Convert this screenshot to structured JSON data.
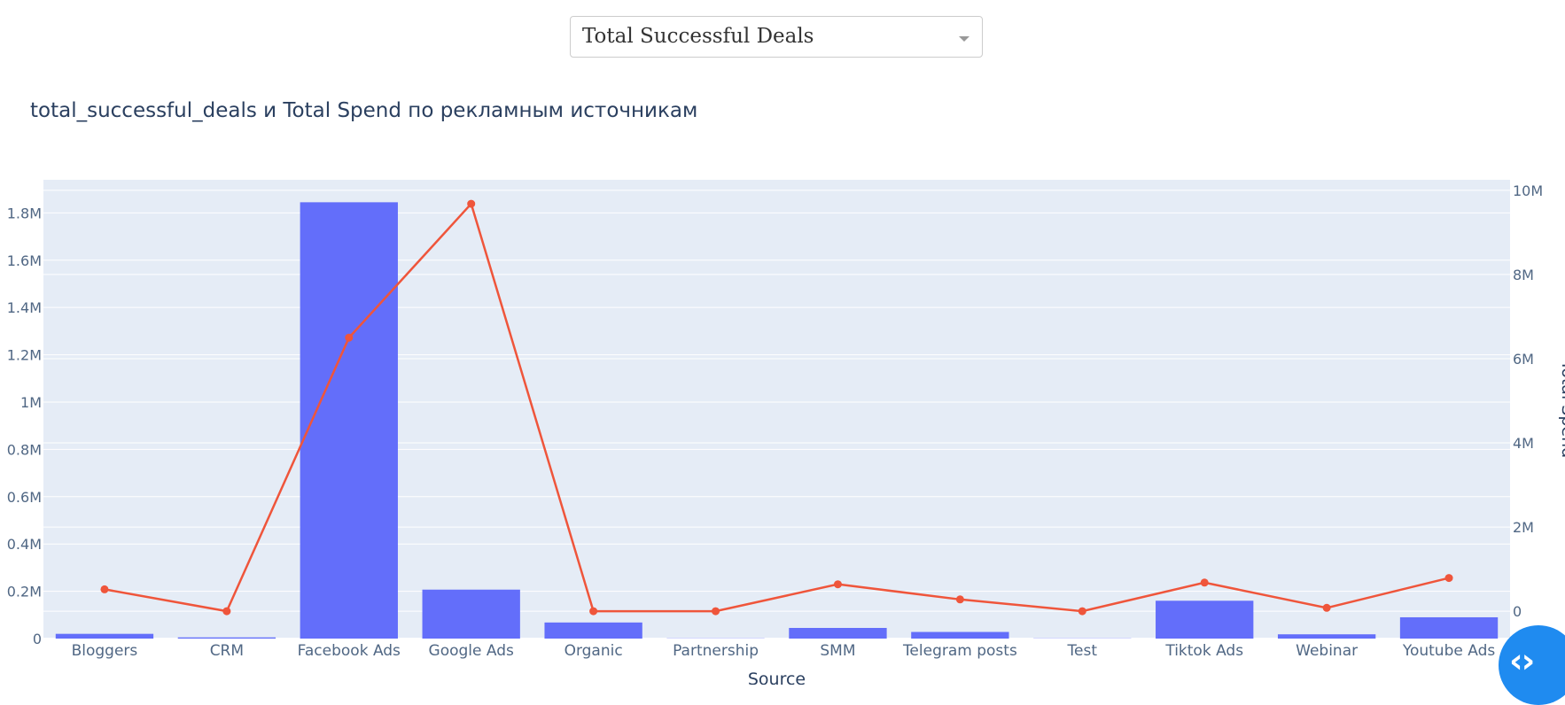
{
  "dropdown": {
    "selected": "Total Successful Deals"
  },
  "nav": {
    "icon": "code-arrows-icon",
    "glyph": "‹›"
  },
  "chart_data": {
    "type": "bar",
    "title": "total_successful_deals и Total Spend по рекламным источникам",
    "xlabel": "Source",
    "ylabel_left": "",
    "ylabel_right": "Total Spend",
    "categories": [
      "Bloggers",
      "CRM",
      "Facebook Ads",
      "Google Ads",
      "Organic",
      "Partnership",
      "SMM",
      "Telegram posts",
      "Test",
      "Tiktok Ads",
      "Webinar",
      "Youtube Ads"
    ],
    "y_left": {
      "range": [
        0,
        1940000
      ],
      "ticks": [
        0,
        200000,
        400000,
        600000,
        800000,
        1000000,
        1200000,
        1400000,
        1600000,
        1800000
      ],
      "tick_labels": [
        "0",
        "0.2M",
        "0.4M",
        "0.6M",
        "0.8M",
        "1M",
        "1.2M",
        "1.4M",
        "1.6M",
        "1.8M"
      ]
    },
    "y_right": {
      "range": [
        -650000,
        10250000
      ],
      "ticks": [
        0,
        2000000,
        4000000,
        6000000,
        8000000,
        10000000
      ],
      "tick_labels": [
        "0",
        "2M",
        "4M",
        "6M",
        "8M",
        "10M"
      ]
    },
    "grid": true,
    "series": [
      {
        "name": "total_successful_deals",
        "type": "bar",
        "axis": "left",
        "color": "#636efa",
        "values": [
          20000,
          5000,
          1845000,
          207000,
          68000,
          1000,
          45000,
          28000,
          1000,
          160000,
          18000,
          90000
        ]
      },
      {
        "name": "Total Spend",
        "type": "line",
        "axis": "right",
        "color": "#ef553b",
        "values": [
          520000,
          0,
          6500000,
          9680000,
          0,
          0,
          640000,
          280000,
          0,
          680000,
          80000,
          790000
        ]
      }
    ]
  }
}
